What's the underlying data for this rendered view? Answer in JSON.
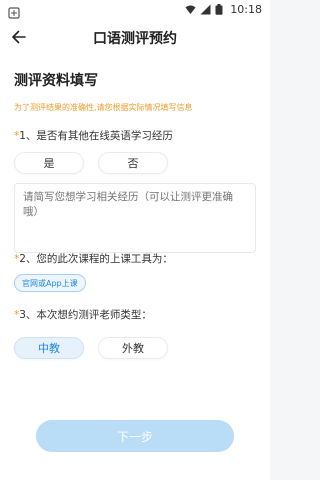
{
  "status_bar": {
    "time": "10:18",
    "icons": [
      "notification-icon",
      "wifi-icon",
      "signal-icon",
      "battery-icon"
    ]
  },
  "header": {
    "title": "口语测评预约",
    "back_icon": "arrow-left-icon"
  },
  "form": {
    "section_title": "测评资料填写",
    "notice": "为了测评结果的准确性,请您根据实际情况填写信息",
    "q1": {
      "star": "*",
      "label": "1、是否有其他在线英语学习经历",
      "options": [
        "是",
        "否"
      ]
    },
    "experience_placeholder": "请简写您想学习相关经历（可以让测评更准确哦）",
    "q2": {
      "star": "*",
      "label": "2、您的此次课程的上课工具为：",
      "tool": "官网或App上课"
    },
    "q3": {
      "star": "*",
      "label": "3、本次想约测评老师类型：",
      "options": [
        "中教",
        "外教"
      ],
      "selected": "中教"
    },
    "next_label": "下一步"
  },
  "colors": {
    "accent": "#1e87e6",
    "warning": "#f29a2e",
    "button_disabled": "#b9dcf7"
  }
}
